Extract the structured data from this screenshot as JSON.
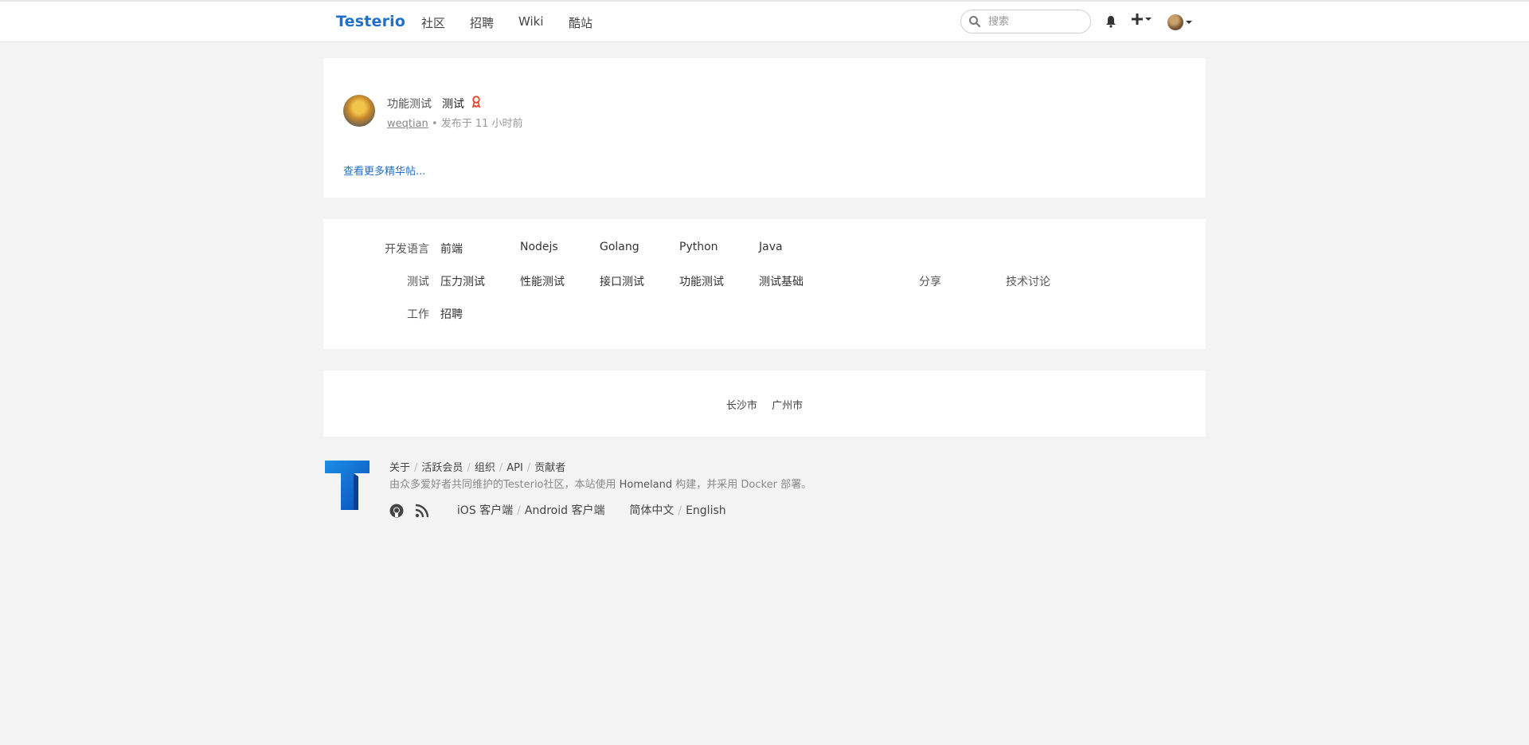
{
  "header": {
    "brand": "Testerio",
    "nav": [
      "社区",
      "招聘",
      "Wiki",
      "酷站"
    ],
    "search_placeholder": "搜索"
  },
  "topic": {
    "category": "功能测试",
    "title": "测试",
    "author": "weqtian",
    "meta": "• 发布于 11 小时前",
    "more_link": "查看更多精华帖..."
  },
  "nodes": [
    {
      "label": "开发语言",
      "items": [
        "前端",
        "Nodejs",
        "Golang",
        "Python",
        "Java"
      ]
    },
    {
      "label": "测试",
      "items": [
        "压力测试",
        "性能测试",
        "接口测试",
        "功能测试",
        "测试基础",
        "分享",
        "技术讨论"
      ]
    },
    {
      "label": "工作",
      "items": [
        "招聘"
      ]
    }
  ],
  "cities": [
    "长沙市",
    "广州市"
  ],
  "footer": {
    "links": [
      "关于",
      "活跃会员",
      "组织",
      "API",
      "贡献者"
    ],
    "desc_prefix": "由众多爱好者共同维护的Testerio社区，本站使用",
    "homeland": "Homeland",
    "desc_mid": "构建，并采用",
    "docker": "Docker",
    "desc_suffix": "部署。",
    "ios": "iOS 客户端",
    "android": "Android 客户端",
    "lang_zh": "简体中文",
    "lang_en": "English"
  },
  "colors": {
    "brand": "#1f6fce",
    "background": "#f3f3f3",
    "award": "#e8412c"
  }
}
